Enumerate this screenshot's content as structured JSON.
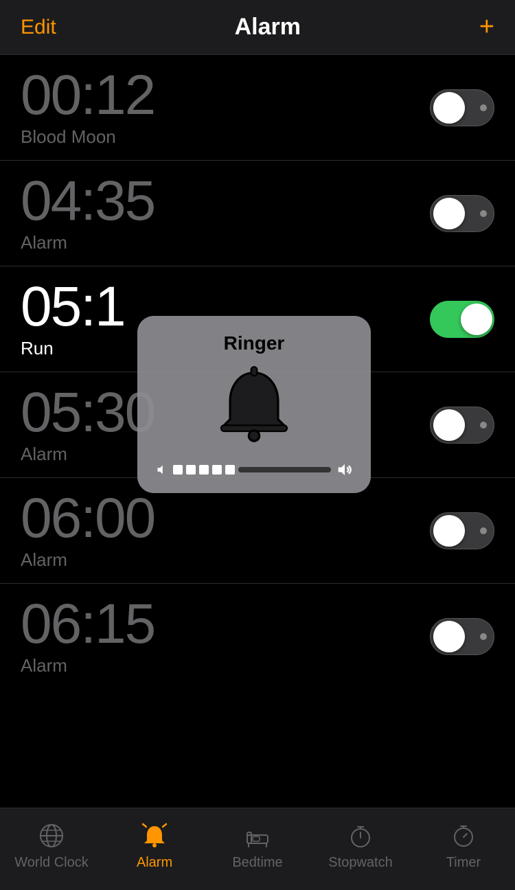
{
  "header": {
    "edit_label": "Edit",
    "title": "Alarm",
    "add_label": "+"
  },
  "alarms": [
    {
      "time": "00:12",
      "label": "Blood Moon",
      "active": false
    },
    {
      "time": "04:35",
      "label": "Alarm",
      "active": false
    },
    {
      "time": "05:1_",
      "label": "Run",
      "active": true
    },
    {
      "time": "05:30",
      "label": "Alarm",
      "active": false
    },
    {
      "time": "06:00",
      "label": "Alarm",
      "active": false
    },
    {
      "time": "06:15",
      "label": "Alarm",
      "active": false
    }
  ],
  "ringer": {
    "title": "Ringer",
    "volume_percent": 38
  },
  "tabs": [
    {
      "label": "World Clock",
      "key": "world-clock",
      "active": false
    },
    {
      "label": "Alarm",
      "key": "alarm",
      "active": true
    },
    {
      "label": "Bedtime",
      "key": "bedtime",
      "active": false
    },
    {
      "label": "Stopwatch",
      "key": "stopwatch",
      "active": false
    },
    {
      "label": "Timer",
      "key": "timer",
      "active": false
    }
  ]
}
